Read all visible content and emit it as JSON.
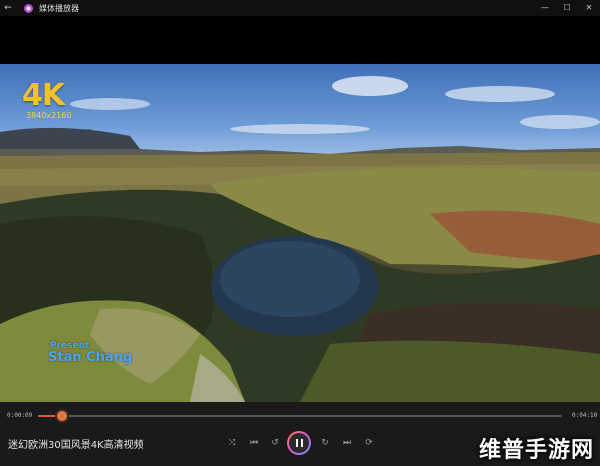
{
  "window": {
    "app_name": "媒体播放器",
    "controls": {
      "minimize": "—",
      "maximize": "☐",
      "close": "✕"
    }
  },
  "video_overlay": {
    "badge": "4K",
    "resolution": "3840x2160",
    "presenter_line1": "Present",
    "presenter_line2": "Stan Chang"
  },
  "player": {
    "current_time": "0:00:09",
    "total_time": "0:04:10",
    "progress_fraction": 0.045,
    "title": "迷幻欧洲30国风景4K高清视频",
    "accent_color": "#d85b3a"
  },
  "watermark": "维普手游网"
}
